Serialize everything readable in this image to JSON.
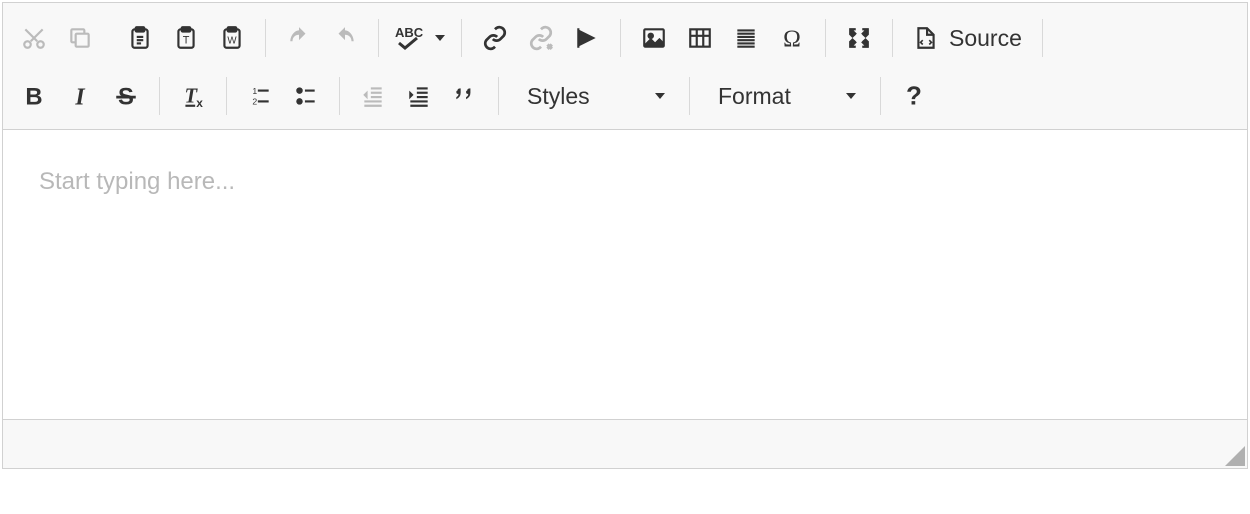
{
  "toolbar": {
    "source_label": "Source",
    "styles_label": "Styles",
    "format_label": "Format"
  },
  "content": {
    "placeholder": "Start typing here..."
  },
  "icons": {
    "cut": "cut-icon",
    "copy": "copy-icon",
    "paste": "paste-icon",
    "paste_text": "paste-text-icon",
    "paste_word": "paste-word-icon",
    "undo": "undo-icon",
    "redo": "redo-icon",
    "spellcheck": "spellcheck-icon",
    "link": "link-icon",
    "unlink": "unlink-icon",
    "anchor": "anchor-icon",
    "image": "image-icon",
    "table": "table-icon",
    "hr": "horizontal-rule-icon",
    "specialchar": "special-char-icon",
    "maximize": "maximize-icon",
    "source": "source-icon",
    "bold": "bold-icon",
    "italic": "italic-icon",
    "strike": "strikethrough-icon",
    "removeformat": "remove-format-icon",
    "numberedlist": "numbered-list-icon",
    "bulletedlist": "bulleted-list-icon",
    "outdent": "outdent-icon",
    "indent": "indent-icon",
    "blockquote": "blockquote-icon",
    "about": "about-icon"
  }
}
